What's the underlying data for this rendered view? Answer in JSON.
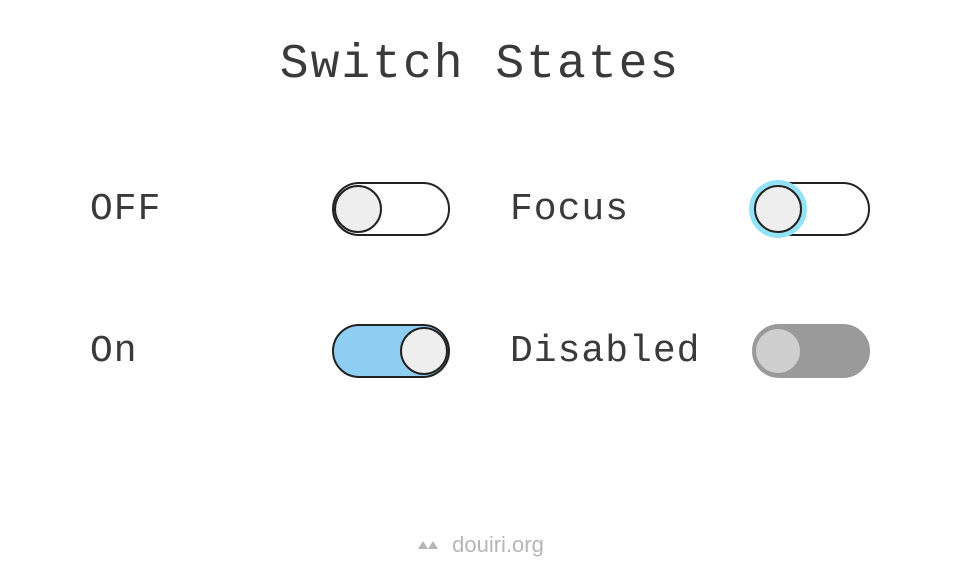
{
  "title": "Switch States",
  "switches": {
    "off": {
      "label": "OFF",
      "state": "off"
    },
    "on": {
      "label": "On",
      "state": "on"
    },
    "focus": {
      "label": "Focus",
      "state": "focus"
    },
    "disabled": {
      "label": "Disabled",
      "state": "disabled"
    }
  },
  "footer": {
    "site": "douiri.org"
  }
}
